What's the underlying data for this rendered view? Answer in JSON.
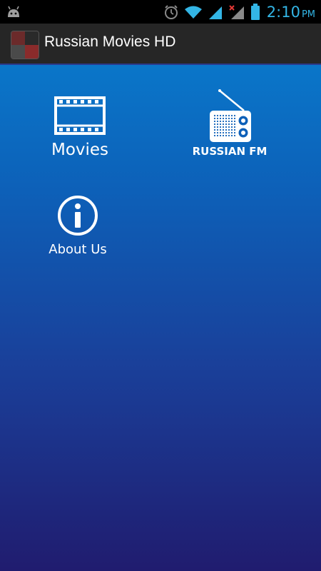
{
  "status_bar": {
    "time": "2:10",
    "ampm": "PM",
    "accent_color": "#33b5e5",
    "icons": [
      "android-notification-icon",
      "alarm-icon",
      "wifi-icon",
      "signal-icon",
      "no-signal-icon",
      "battery-icon"
    ]
  },
  "action_bar": {
    "title": "Russian Movies HD",
    "icon": "app-logo"
  },
  "menu": {
    "movies_label": "Movies",
    "radio_label": "RUSSIAN FM",
    "about_label": "About Us"
  },
  "colors": {
    "gradient_top": "#0a76c9",
    "gradient_bottom": "#201c6f",
    "action_bar_bg": "#262626"
  }
}
